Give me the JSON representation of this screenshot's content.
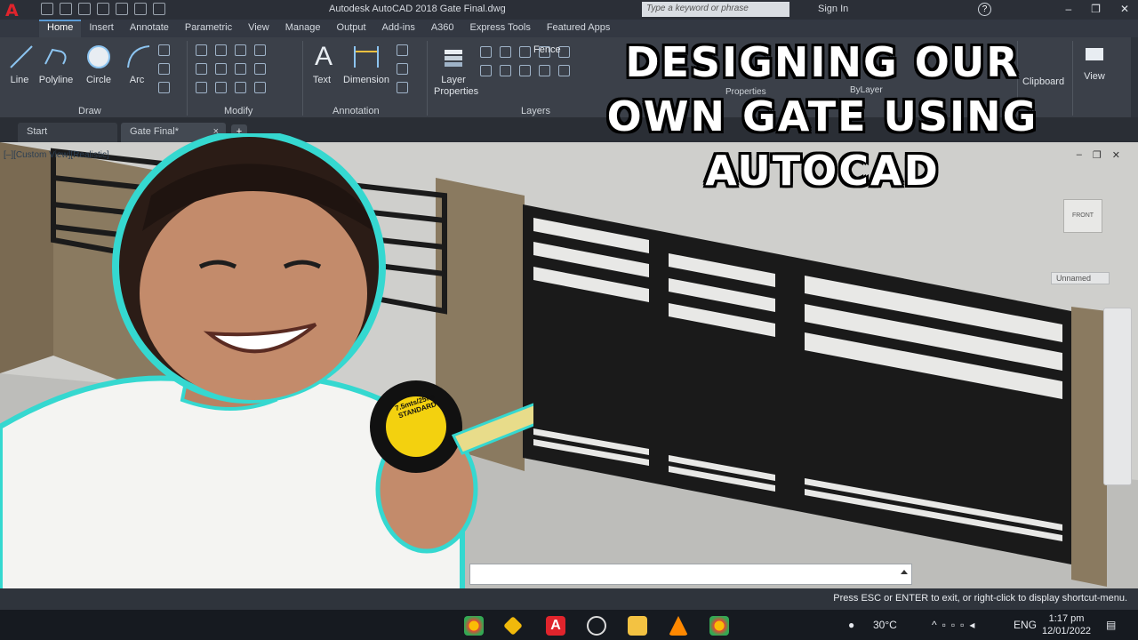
{
  "app": {
    "title": "Autodesk AutoCAD 2018    Gate Final.dwg",
    "search_placeholder": "Type a keyword or phrase",
    "sign_in": "Sign In",
    "help": "?"
  },
  "ribbon_tabs": [
    "Home",
    "Insert",
    "Annotate",
    "Parametric",
    "View",
    "Manage",
    "Output",
    "Add-ins",
    "A360",
    "Express Tools",
    "Featured Apps"
  ],
  "draw_tools": [
    "Line",
    "Polyline",
    "Circle",
    "Arc"
  ],
  "panels": {
    "draw": "Draw",
    "modify": "Modify",
    "annotation": "Annotation",
    "layers": "Layers",
    "text": "Text",
    "dimension": "Dimension",
    "layer_properties": "Layer Properties",
    "fence": "Fence",
    "properties": "Properties",
    "bylayer": "ByLayer",
    "clipboard": "Clipboard",
    "view": "View"
  },
  "file_tabs": [
    "Start",
    "Gate Final*"
  ],
  "viewport": {
    "label": "[–][Custom View][Realistic]",
    "navcube_face": "FRONT",
    "named_view": "Unnamed"
  },
  "overlay_title": [
    "DESIGNING OUR",
    "OWN GATE USING",
    "AUTOCAD"
  ],
  "tape_label": [
    "7.5mts/25fts",
    "STANDARD"
  ],
  "status": {
    "message": "Press ESC or ENTER to exit, or right-click to display shortcut-menu."
  },
  "taskbar": {
    "temperature": "30°C",
    "language": "ENG",
    "time": "1:17 pm",
    "date": "12/01/2022"
  },
  "colors": {
    "autocad_red": "#e0242c",
    "overlay_outline": "#000000",
    "person_outline": "#35d8d0"
  }
}
